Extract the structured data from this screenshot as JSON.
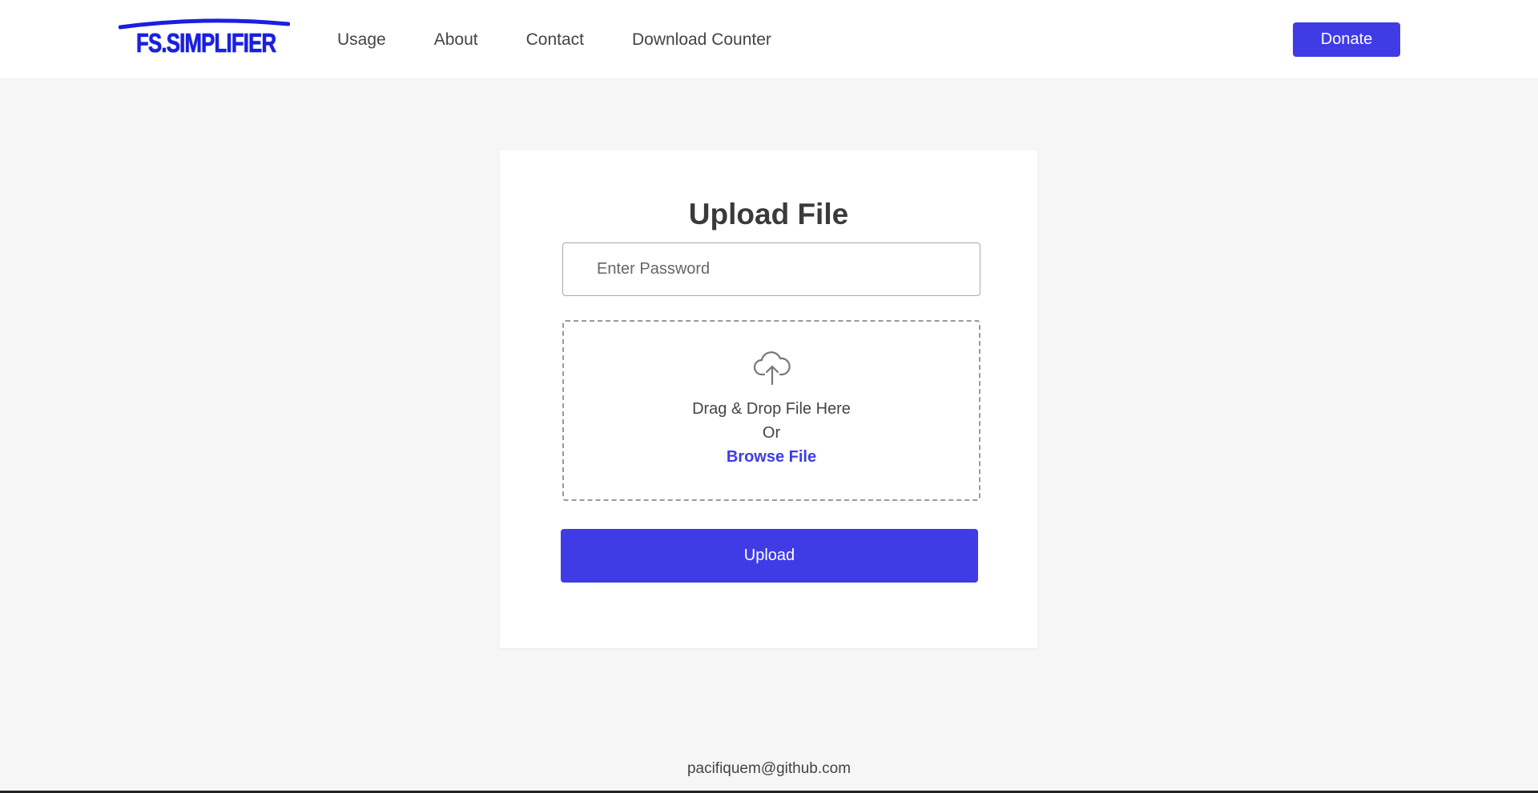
{
  "header": {
    "logo_text": "FS.SIMPLIFIER",
    "nav_items": [
      {
        "label": "Usage"
      },
      {
        "label": "About"
      },
      {
        "label": "Contact"
      },
      {
        "label": "Download Counter"
      }
    ],
    "donate_label": "Donate"
  },
  "main": {
    "title": "Upload File",
    "password_placeholder": "Enter Password",
    "password_value": "",
    "dropzone": {
      "icon": "cloud-upload-icon",
      "main_text": "Drag & Drop File Here",
      "or_text": "Or",
      "browse_label": "Browse File"
    },
    "upload_label": "Upload"
  },
  "footer": {
    "email": "pacifiquem@github.com"
  },
  "colors": {
    "accent": "#3f3ce6",
    "background": "#f6f6f6",
    "card": "#ffffff",
    "logo": "#1a1fe0"
  }
}
